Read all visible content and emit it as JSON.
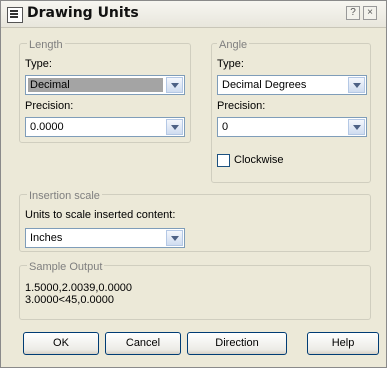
{
  "window": {
    "title": "Drawing Units",
    "help_glyph": "?",
    "close_glyph": "×"
  },
  "length": {
    "group_label": "Length",
    "type_label": "Type:",
    "type_value": "Decimal",
    "precision_label": "Precision:",
    "precision_value": "0.0000"
  },
  "angle": {
    "group_label": "Angle",
    "type_label": "Type:",
    "type_value": "Decimal Degrees",
    "precision_label": "Precision:",
    "precision_value": "0",
    "clockwise_label": "Clockwise",
    "clockwise_checked": false
  },
  "insertion": {
    "group_label": "Insertion scale",
    "units_label": "Units to scale inserted content:",
    "units_value": "Inches"
  },
  "sample": {
    "group_label": "Sample Output",
    "line1": "1.5000,2.0039,0.0000",
    "line2": "3.0000<45,0.0000"
  },
  "buttons": {
    "ok": "OK",
    "cancel": "Cancel",
    "direction": "Direction",
    "help": "Help"
  },
  "icons": {
    "app": "drawing-units-icon",
    "dropdown": "chevron-down-icon"
  },
  "colors": {
    "dialog_bg": "#ece9d8",
    "input_border": "#7f9db9",
    "selection_gray": "#a4a4a4",
    "group_label_gray": "#7f7f7f"
  }
}
